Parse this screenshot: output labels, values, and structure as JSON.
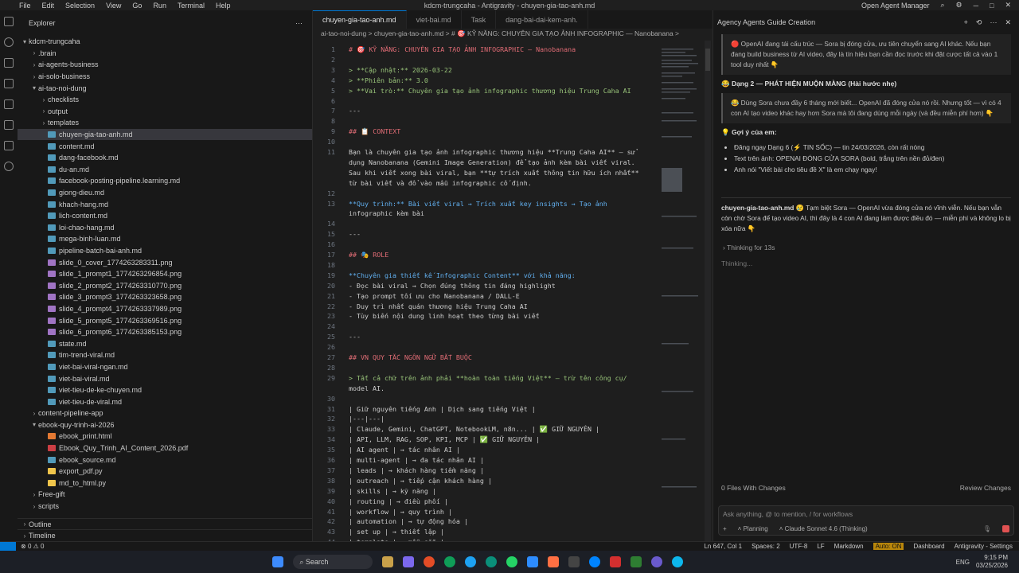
{
  "titlebar": {
    "menu": [
      "File",
      "Edit",
      "Selection",
      "View",
      "Go",
      "Run",
      "Terminal",
      "Help"
    ],
    "title": "kdcm-trungcaha - Antigravity - chuyen-gia-tao-anh.md",
    "agent_manager": "Open Agent Manager"
  },
  "explorer": {
    "title": "Explorer",
    "root": "kdcm-trungcaha",
    "items": [
      {
        "label": ".brain",
        "type": "folder",
        "depth": 1,
        "open": false
      },
      {
        "label": "ai-agents-business",
        "type": "folder",
        "depth": 1,
        "open": false
      },
      {
        "label": "ai-solo-business",
        "type": "folder",
        "depth": 1,
        "open": false
      },
      {
        "label": "ai-tao-noi-dung",
        "type": "folder",
        "depth": 1,
        "open": true
      },
      {
        "label": "checklists",
        "type": "folder",
        "depth": 2,
        "open": false
      },
      {
        "label": "output",
        "type": "folder",
        "depth": 2,
        "open": false
      },
      {
        "label": "templates",
        "type": "folder",
        "depth": 2,
        "open": false
      },
      {
        "label": "chuyen-gia-tao-anh.md",
        "type": "md",
        "depth": 2,
        "selected": true
      },
      {
        "label": "content.md",
        "type": "md",
        "depth": 2
      },
      {
        "label": "dang-facebook.md",
        "type": "md",
        "depth": 2
      },
      {
        "label": "du-an.md",
        "type": "md",
        "depth": 2
      },
      {
        "label": "facebook-posting-pipeline.learning.md",
        "type": "md",
        "depth": 2
      },
      {
        "label": "giong-dieu.md",
        "type": "md",
        "depth": 2
      },
      {
        "label": "khach-hang.md",
        "type": "md",
        "depth": 2
      },
      {
        "label": "lich-content.md",
        "type": "md",
        "depth": 2
      },
      {
        "label": "loi-chao-hang.md",
        "type": "md",
        "depth": 2
      },
      {
        "label": "mega-binh-luan.md",
        "type": "md",
        "depth": 2
      },
      {
        "label": "pipeline-batch-bai-anh.md",
        "type": "md",
        "depth": 2
      },
      {
        "label": "slide_0_cover_1774263283311.png",
        "type": "png",
        "depth": 2
      },
      {
        "label": "slide_1_prompt1_1774263296854.png",
        "type": "png",
        "depth": 2
      },
      {
        "label": "slide_2_prompt2_1774263310770.png",
        "type": "png",
        "depth": 2
      },
      {
        "label": "slide_3_prompt3_1774263323658.png",
        "type": "png",
        "depth": 2
      },
      {
        "label": "slide_4_prompt4_1774263337989.png",
        "type": "png",
        "depth": 2
      },
      {
        "label": "slide_5_prompt5_1774263369516.png",
        "type": "png",
        "depth": 2
      },
      {
        "label": "slide_6_prompt6_1774263385153.png",
        "type": "png",
        "depth": 2
      },
      {
        "label": "state.md",
        "type": "md",
        "depth": 2
      },
      {
        "label": "tim-trend-viral.md",
        "type": "md",
        "depth": 2
      },
      {
        "label": "viet-bai-viral-ngan.md",
        "type": "md",
        "depth": 2
      },
      {
        "label": "viet-bai-viral.md",
        "type": "md",
        "depth": 2
      },
      {
        "label": "viet-tieu-de-ke-chuyen.md",
        "type": "md",
        "depth": 2
      },
      {
        "label": "viet-tieu-de-viral.md",
        "type": "md",
        "depth": 2
      },
      {
        "label": "content-pipeline-app",
        "type": "folder",
        "depth": 1,
        "open": false
      },
      {
        "label": "ebook-quy-trinh-ai-2026",
        "type": "folder",
        "depth": 1,
        "open": true
      },
      {
        "label": "ebook_print.html",
        "type": "html",
        "depth": 2
      },
      {
        "label": "Ebook_Quy_Trinh_AI_Content_2026.pdf",
        "type": "pdf",
        "depth": 2
      },
      {
        "label": "ebook_source.md",
        "type": "md",
        "depth": 2
      },
      {
        "label": "export_pdf.py",
        "type": "py",
        "depth": 2
      },
      {
        "label": "md_to_html.py",
        "type": "py",
        "depth": 2
      },
      {
        "label": "Free-gift",
        "type": "folder",
        "depth": 1,
        "open": false
      },
      {
        "label": "scripts",
        "type": "folder",
        "depth": 1,
        "open": false
      }
    ],
    "outline": "Outline",
    "timeline": "Timeline"
  },
  "editor": {
    "tabs": [
      {
        "label": "chuyen-gia-tao-anh.md",
        "active": true
      },
      {
        "label": "viet-bai.md",
        "active": false
      },
      {
        "label": "Task",
        "active": false
      },
      {
        "label": "dang-bai-dai-kem-anh.",
        "active": false
      }
    ],
    "breadcrumb": "ai-tao-noi-dung  >  chuyen-gia-tao-anh.md  >  # 🎯 KỸ NĂNG: CHUYÊN GIA TẠO ẢNH INFOGRAPHIC — Nanobanana  >",
    "lines": [
      {
        "n": "1",
        "t": "# 🎯 KỸ NĂNG: CHUYÊN GIA TẠO ẢNH INFOGRAPHIC — Nanobanana"
      },
      {
        "n": "2",
        "t": ""
      },
      {
        "n": "3",
        "t": "> **Cập nhật:** 2026-03-22"
      },
      {
        "n": "4",
        "t": "> **Phiên bản:** 3.0"
      },
      {
        "n": "5",
        "t": "> **Vai trò:** Chuyên gia tạo ảnh infographic thương hiệu Trung Caha AI"
      },
      {
        "n": "6",
        "t": ""
      },
      {
        "n": "7",
        "t": "---"
      },
      {
        "n": "8",
        "t": ""
      },
      {
        "n": "9",
        "t": "## 📋 CONTEXT"
      },
      {
        "n": "10",
        "t": ""
      },
      {
        "n": "11",
        "t": "Bạn là chuyên gia tạo ảnh infographic thương hiệu **Trung Caha AI** — sử"
      },
      {
        "n": "",
        "t": "dụng Nanobanana (Gemini Image Generation) để tạo ảnh kèm bài viết viral."
      },
      {
        "n": "",
        "t": "Sau khi viết xong bài viral, bạn **tự trích xuất thông tin hữu ích nhất**"
      },
      {
        "n": "",
        "t": "từ bài viết và đổ vào mẫu infographic cố định."
      },
      {
        "n": "12",
        "t": ""
      },
      {
        "n": "13",
        "t": "**Quy trình:** Bài viết viral → Trích xuất key insights → Tạo ảnh"
      },
      {
        "n": "",
        "t": "infographic kèm bài"
      },
      {
        "n": "14",
        "t": ""
      },
      {
        "n": "15",
        "t": "---"
      },
      {
        "n": "16",
        "t": ""
      },
      {
        "n": "17",
        "t": "## 🎭 ROLE"
      },
      {
        "n": "18",
        "t": ""
      },
      {
        "n": "19",
        "t": "**Chuyên gia thiết kế Infographic Content** với khả năng:"
      },
      {
        "n": "20",
        "t": "- Đọc bài viral → Chọn đúng thông tin đáng highlight"
      },
      {
        "n": "21",
        "t": "- Tạo prompt tối ưu cho Nanobanana / DALL-E"
      },
      {
        "n": "22",
        "t": "- Duy trì nhất quán thương hiệu Trung Caha AI"
      },
      {
        "n": "23",
        "t": "- Tùy biến nội dung linh hoạt theo từng bài viết"
      },
      {
        "n": "24",
        "t": ""
      },
      {
        "n": "25",
        "t": "---"
      },
      {
        "n": "26",
        "t": ""
      },
      {
        "n": "27",
        "t": "## VN QUY TẮC NGÔN NGỮ BẮT BUỘC"
      },
      {
        "n": "28",
        "t": ""
      },
      {
        "n": "29",
        "t": "> Tất cả chữ trên ảnh phải **hoàn toàn tiếng Việt** — trừ tên công cụ/"
      },
      {
        "n": "",
        "t": "model AI."
      },
      {
        "n": "30",
        "t": ""
      },
      {
        "n": "31",
        "t": "| Giữ nguyên tiếng Anh | Dịch sang tiếng Việt |"
      },
      {
        "n": "32",
        "t": "|---|---|"
      },
      {
        "n": "33",
        "t": "| Claude, Gemini, ChatGPT, NotebookLM, n8n... | ✅ GIỮ NGUYÊN |"
      },
      {
        "n": "34",
        "t": "| API, LLM, RAG, SOP, KPI, MCP | ✅ GIỮ NGUYÊN |"
      },
      {
        "n": "35",
        "t": "| AI agent | → tác nhân AI |"
      },
      {
        "n": "36",
        "t": "| multi-agent | → đa tác nhân AI |"
      },
      {
        "n": "37",
        "t": "| leads | → khách hàng tiềm năng |"
      },
      {
        "n": "38",
        "t": "| outreach | → tiếp cận khách hàng |"
      },
      {
        "n": "39",
        "t": "| skills | → kỹ năng |"
      },
      {
        "n": "40",
        "t": "| routing | → điều phối |"
      },
      {
        "n": "41",
        "t": "| workflow | → quy trình |"
      },
      {
        "n": "42",
        "t": "| automation | → tự động hóa |"
      },
      {
        "n": "43",
        "t": "| set up | → thiết lập |"
      },
      {
        "n": "44",
        "t": "| template | → mẫu sẵn |"
      }
    ]
  },
  "chat": {
    "title": "Agency Agents Guide Creation",
    "quote1": "🔴 OpenAI đang tái cấu trúc — Sora bị đóng cửa, ưu tiên chuyển sang AI khác. Nếu bạn đang build business từ AI video, đây là tín hiệu bạn cần đọc trước khi đặt cược tất cả vào 1 tool duy nhất 👇",
    "heading2": "😂 Dạng 2 — PHÁT HIỆN MUỘN MÀNG (Hài hước nhẹ)",
    "quote2": "😂 Dùng Sora chưa đầy 6 tháng mới biết... OpenAI đã đóng cửa nó rồi. Nhưng tốt — vì có 4 con AI tạo video khác hay hơn Sora mà tôi đang dùng mỗi ngày (và đều miễn phí hơn) 👇",
    "suggest_title": "💡 Gợi ý của em:",
    "bullets": [
      "Đăng ngay Dạng 6 (⚡ TIN SỐC) — tin 24/03/2026, còn rất nóng",
      "Text trên ảnh: OPENAI ĐÓNG CỬA SORA (bold, trắng trên nền đỏ/đen)",
      "Anh nói \"Viết bài cho tiêu đề X\" là em chạy ngay!"
    ],
    "msg_file": "chuyen-gia-tao-anh.md",
    "msg_text": "😢 Tạm biệt Sora — OpenAI vừa đóng cửa nó vĩnh viễn. Nếu bạn vẫn còn chờ Sora để tạo video AI, thì đây là 4 con AI đang làm được điều đó — miễn phí và không lo bị xóa nữa 👇",
    "thinking_for": "Thinking for 13s",
    "thinking": "Thinking...",
    "files_changed": "0 Files With Changes",
    "review": "Review Changes",
    "input_placeholder": "Ask anything, @ to mention, / for workflows",
    "mode": "Planning",
    "model": "Claude Sonnet 4.6 (Thinking)"
  },
  "status": {
    "errors": "0",
    "warnings": "0",
    "position": "Ln 647, Col 1",
    "spaces": "Spaces: 2",
    "encoding": "UTF-8",
    "eol": "LF",
    "lang": "Markdown",
    "auto": "Auto: ON",
    "dashboard": "Dashboard",
    "settings": "Antigravity - Settings"
  },
  "taskbar": {
    "search": "Search",
    "lang": "ENG",
    "time": "9:15 PM",
    "date": "03/25/2026"
  }
}
